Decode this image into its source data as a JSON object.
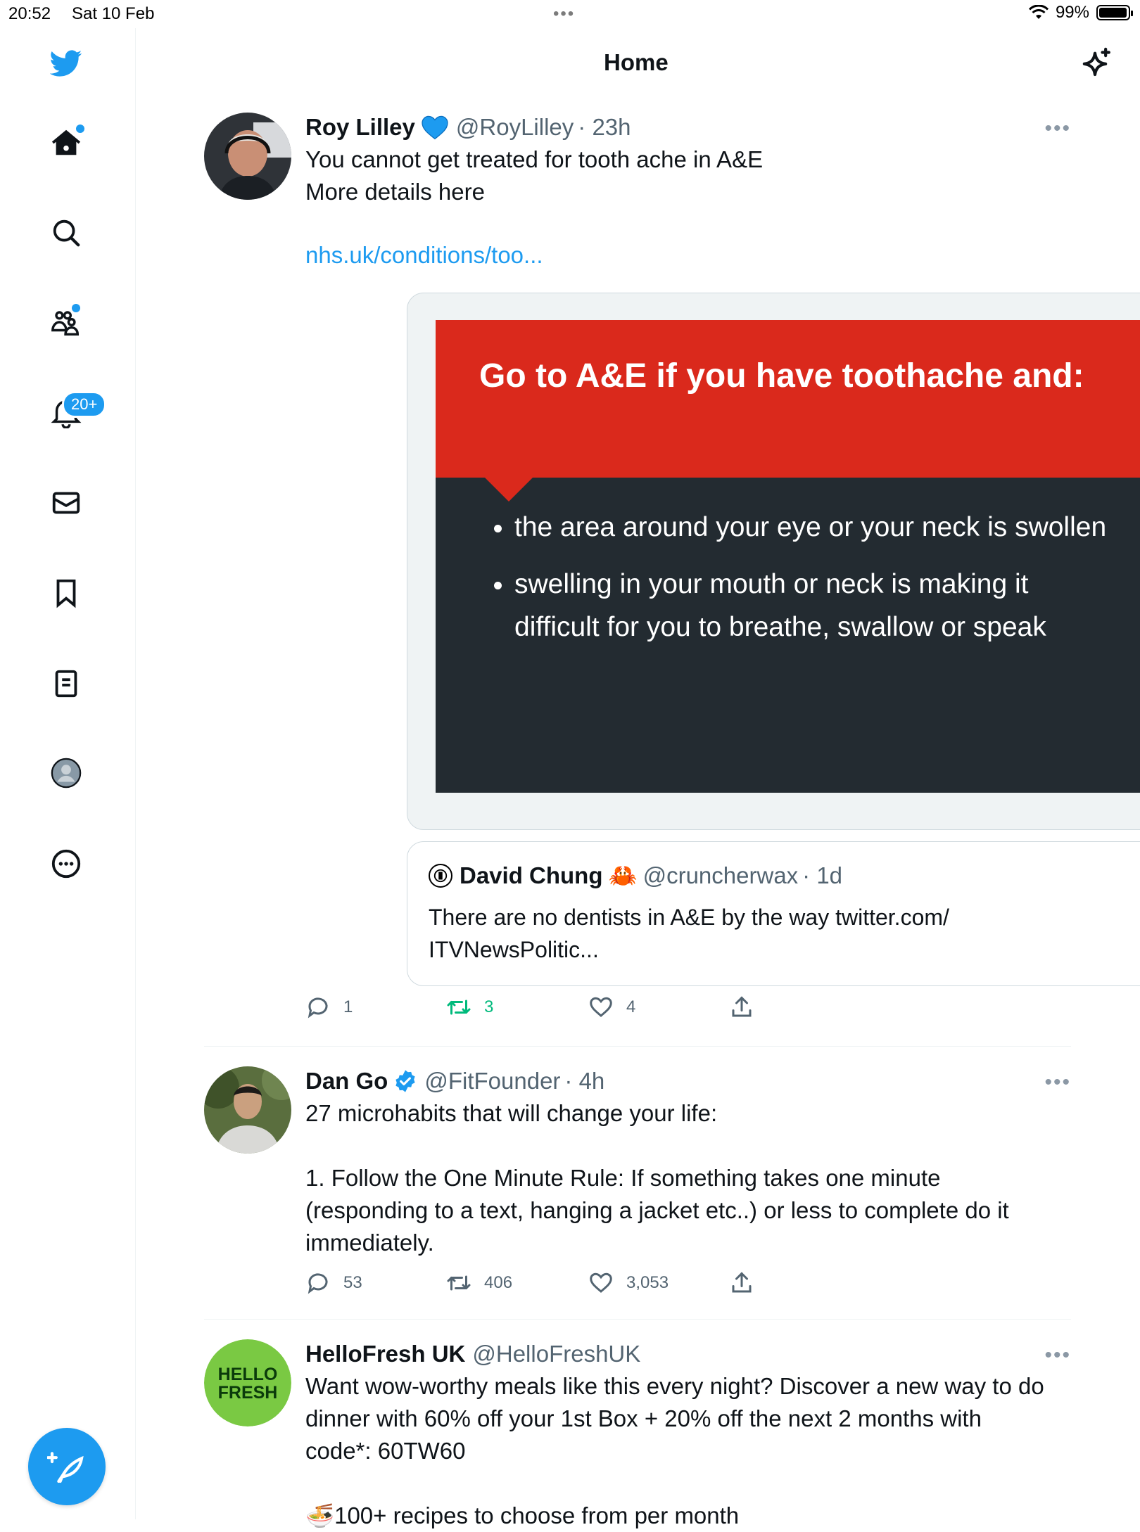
{
  "status": {
    "time": "20:52",
    "date": "Sat 10 Feb",
    "dots": "•••",
    "battery": "99%"
  },
  "header": {
    "title": "Home"
  },
  "nav": {
    "notifications_badge": "20+"
  },
  "tweets": [
    {
      "name": "Roy Lilley",
      "handle": "@RoyLilley",
      "time": "· 23h",
      "more": "•••",
      "text": "You cannot get treated for tooth ache in A&E\nMore details here",
      "link": "nhs.uk/conditions/too...",
      "card": {
        "heading": "Go to A&E if you have toothache and:",
        "bullets": [
          "the area around your eye or your neck is swollen",
          "swelling in your mouth or neck is making it difficult for you to breathe, swallow or speak"
        ]
      },
      "quote": {
        "name": "David Chung",
        "emoji": "🦀",
        "handle": "@cruncherwax",
        "time": "· 1d",
        "text": "There are no dentists in A&E by the way twitter.com/\nITVNewsPolitic..."
      },
      "replies": "1",
      "retweets": "3",
      "likes": "4"
    },
    {
      "name": "Dan Go",
      "handle": "@FitFounder",
      "time": "· 4h",
      "more": "•••",
      "text": "27 microhabits that will change your life:\n\n1. Follow the One Minute Rule: If something takes one minute\n(responding to a text, hanging a jacket etc..) or less to complete do it\nimmediately.",
      "replies": "53",
      "retweets": "406",
      "likes": "3,053"
    },
    {
      "name": "HelloFresh UK",
      "handle": "@HelloFreshUK",
      "more": "•••",
      "text": "Want wow-worthy meals like this every night? Discover a new way to do\ndinner with 60% off your 1st Box + 20% off the next 2 months with\ncode*: 60TW60",
      "partial": "🍜100+ recipes to choose from per month",
      "logo_text": "HELLO FRESH"
    }
  ],
  "colors": {
    "accent": "#1d9bf0",
    "retweet_green": "#00ba7c",
    "nhs_red": "#da291c",
    "nhs_dark": "#232b31"
  }
}
